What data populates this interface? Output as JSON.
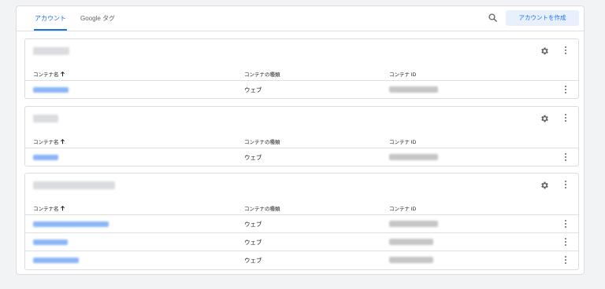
{
  "tabs": [
    {
      "label": "アカウント",
      "active": true
    },
    {
      "label": "Google タグ",
      "active": false
    }
  ],
  "toolbar": {
    "search_icon": "search-icon",
    "create_label": "アカウントを作成"
  },
  "table_headers": {
    "name": "コンテナ名",
    "sort_icon": "arrow-up-icon",
    "type": "コンテナの種類",
    "id": "コンテナ ID"
  },
  "accounts": [
    {
      "rows": [
        {
          "type": "ウェブ"
        }
      ]
    },
    {
      "rows": [
        {
          "type": "ウェブ"
        }
      ]
    },
    {
      "rows": [
        {
          "type": "ウェブ"
        },
        {
          "type": "ウェブ"
        },
        {
          "type": "ウェブ"
        }
      ]
    }
  ],
  "colors": {
    "accent": "#1a73e8",
    "accent_bg": "#e8f0fe",
    "page_bg": "#f1f3f4",
    "border": "#dadce0"
  }
}
